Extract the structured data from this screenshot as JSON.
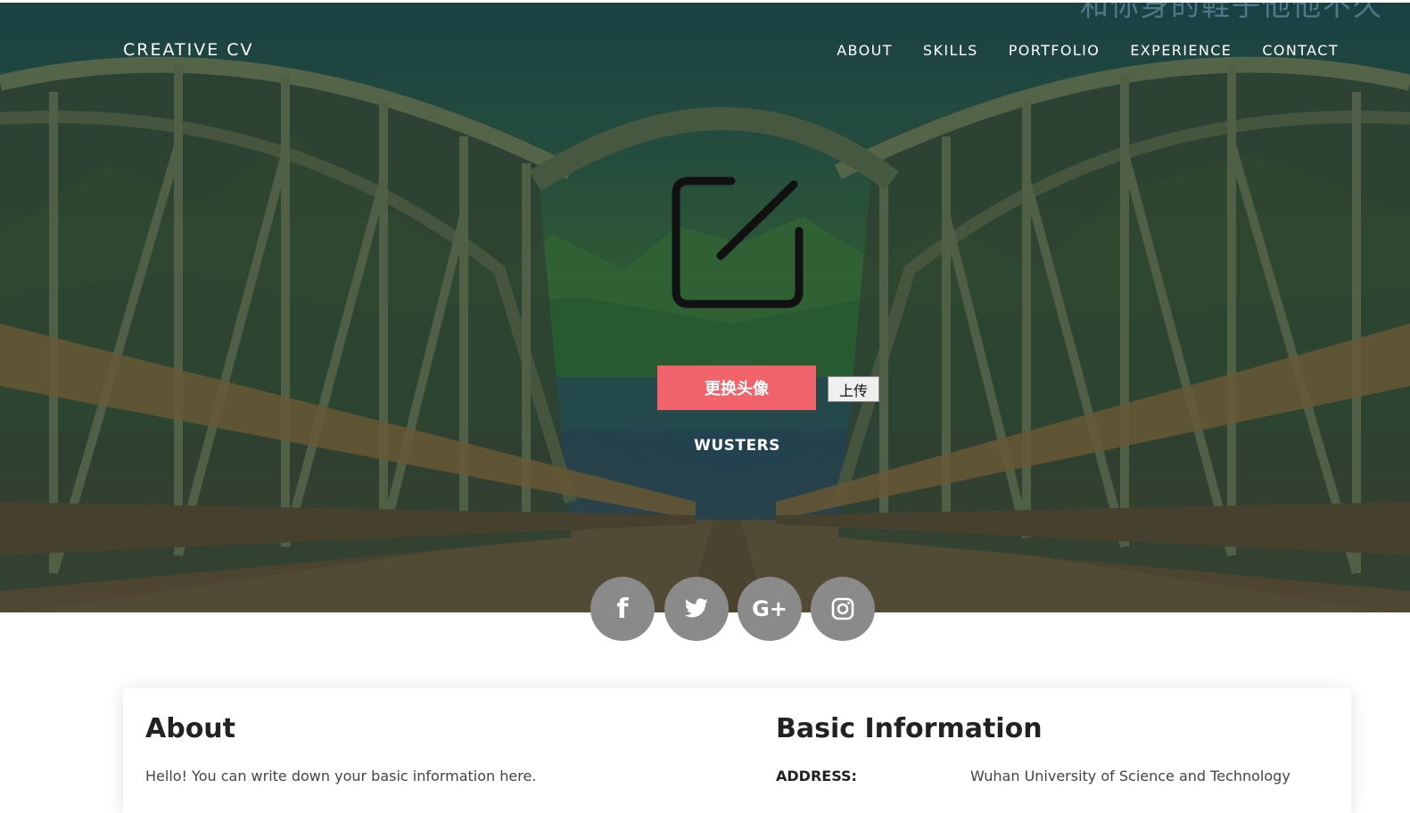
{
  "watermark": "和你身的鞋子他他不久",
  "header": {
    "brand": "CREATIVE CV",
    "nav": [
      "ABOUT",
      "SKILLS",
      "PORTFOLIO",
      "EXPERIENCE",
      "CONTACT"
    ]
  },
  "hero": {
    "avatar_icon": "edit-square-icon",
    "change_avatar_label": "更换头像",
    "upload_label": "上传",
    "name": "WUSTERS",
    "social": [
      {
        "icon": "facebook-icon",
        "glyph": "f"
      },
      {
        "icon": "twitter-icon",
        "glyph": ""
      },
      {
        "icon": "google-plus-icon",
        "glyph": "G+"
      },
      {
        "icon": "instagram-icon",
        "glyph": ""
      }
    ]
  },
  "about": {
    "title": "About",
    "text": "Hello! You can write down your basic information here."
  },
  "basic_info": {
    "title": "Basic Information",
    "address_label": "ADDRESS:",
    "address_value": "Wuhan University of Science and Technology"
  },
  "colors": {
    "accent": "#f0636a",
    "social_bg": "#8a8a8a",
    "text_dark": "#222222"
  }
}
